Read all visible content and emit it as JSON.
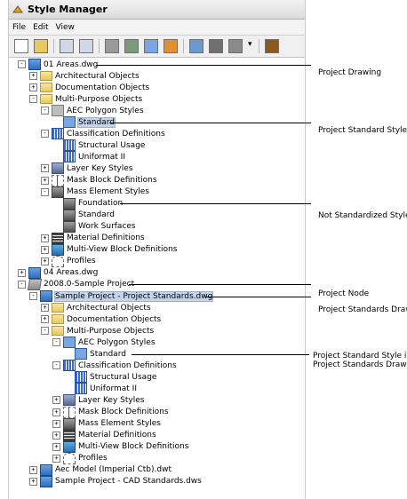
{
  "window": {
    "title": "Style Manager"
  },
  "menu": [
    "File",
    "Edit",
    "View"
  ],
  "toolbar": [
    "new-icon",
    "open-icon",
    "copy-icon",
    "paste-icon",
    "edit-icon",
    "filter-icon",
    "purge-icon",
    "sort-icon",
    "settings-icon",
    "funnel-icon",
    "view-icon",
    "dropdown-icon",
    "help-icon"
  ],
  "tree": [
    {
      "label": "01 Areas.dwg",
      "level": 0,
      "exp": "-",
      "icon": "dwg"
    },
    {
      "label": "Architectural Objects",
      "level": 1,
      "exp": "+",
      "icon": "folder"
    },
    {
      "label": "Documentation Objects",
      "level": 1,
      "exp": "+",
      "icon": "folder"
    },
    {
      "label": "Multi-Purpose Objects",
      "level": 1,
      "exp": "-",
      "icon": "folder"
    },
    {
      "label": "AEC Polygon Styles",
      "level": 2,
      "exp": "-",
      "icon": "gray"
    },
    {
      "label": "Standard",
      "level": 3,
      "exp": "",
      "icon": "style",
      "selected": true
    },
    {
      "label": "Classification Definitions",
      "level": 2,
      "exp": "-",
      "icon": "cls"
    },
    {
      "label": "Structural Usage",
      "level": 3,
      "exp": "",
      "icon": "cls"
    },
    {
      "label": "Uniformat II",
      "level": 3,
      "exp": "",
      "icon": "cls"
    },
    {
      "label": "Layer Key Styles",
      "level": 2,
      "exp": "+",
      "icon": "layer"
    },
    {
      "label": "Mask Block Definitions",
      "level": 2,
      "exp": "+",
      "icon": "mask"
    },
    {
      "label": "Mass Element Styles",
      "level": 2,
      "exp": "-",
      "icon": "mass"
    },
    {
      "label": "Foundation",
      "level": 3,
      "exp": "",
      "icon": "mass"
    },
    {
      "label": "Standard",
      "level": 3,
      "exp": "",
      "icon": "mass"
    },
    {
      "label": "Work Surfaces",
      "level": 3,
      "exp": "",
      "icon": "mass"
    },
    {
      "label": "Material Definitions",
      "level": 2,
      "exp": "+",
      "icon": "mat"
    },
    {
      "label": "Multi-View Block Definitions",
      "level": 2,
      "exp": "+",
      "icon": "mv"
    },
    {
      "label": "Profiles",
      "level": 2,
      "exp": "+",
      "icon": "profile"
    },
    {
      "label": "04 Areas.dwg",
      "level": 0,
      "exp": "+",
      "icon": "dwg"
    },
    {
      "label": "2008.0-Sample Project",
      "level": 0,
      "exp": "-",
      "icon": "proj"
    },
    {
      "label": "Sample Project - Project Standards.dwg",
      "level": 1,
      "exp": "-",
      "icon": "dwg",
      "selected": true
    },
    {
      "label": "Architectural Objects",
      "level": 2,
      "exp": "+",
      "icon": "folder"
    },
    {
      "label": "Documentation Objects",
      "level": 2,
      "exp": "+",
      "icon": "folder"
    },
    {
      "label": "Multi-Purpose Objects",
      "level": 2,
      "exp": "-",
      "icon": "folder"
    },
    {
      "label": "AEC Polygon Styles",
      "level": 3,
      "exp": "-",
      "icon": "style"
    },
    {
      "label": "Standard",
      "level": 4,
      "exp": "",
      "icon": "style"
    },
    {
      "label": "Classification Definitions",
      "level": 3,
      "exp": "-",
      "icon": "cls"
    },
    {
      "label": "Structural Usage",
      "level": 4,
      "exp": "",
      "icon": "cls"
    },
    {
      "label": "Uniformat II",
      "level": 4,
      "exp": "",
      "icon": "cls"
    },
    {
      "label": "Layer Key Styles",
      "level": 3,
      "exp": "+",
      "icon": "layer"
    },
    {
      "label": "Mask Block Definitions",
      "level": 3,
      "exp": "+",
      "icon": "mask"
    },
    {
      "label": "Mass Element Styles",
      "level": 3,
      "exp": "+",
      "icon": "mass"
    },
    {
      "label": "Material Definitions",
      "level": 3,
      "exp": "+",
      "icon": "mat"
    },
    {
      "label": "Multi-View Block Definitions",
      "level": 3,
      "exp": "+",
      "icon": "mv"
    },
    {
      "label": "Profiles",
      "level": 3,
      "exp": "+",
      "icon": "profile"
    },
    {
      "label": "Aec Model (Imperial Ctb).dwt",
      "level": 1,
      "exp": "+",
      "icon": "dwg"
    },
    {
      "label": "Sample Project - CAD Standards.dws",
      "level": 1,
      "exp": "+",
      "icon": "dwg"
    }
  ],
  "annotations": [
    {
      "text": "Project Drawing"
    },
    {
      "text": "Project Standard Style"
    },
    {
      "text": "Not Standardized Style"
    },
    {
      "text": "Project Node"
    },
    {
      "text": "Project Standards Drawing"
    },
    {
      "text": "Project Standard Style in\nProject Standards Drawing"
    }
  ]
}
